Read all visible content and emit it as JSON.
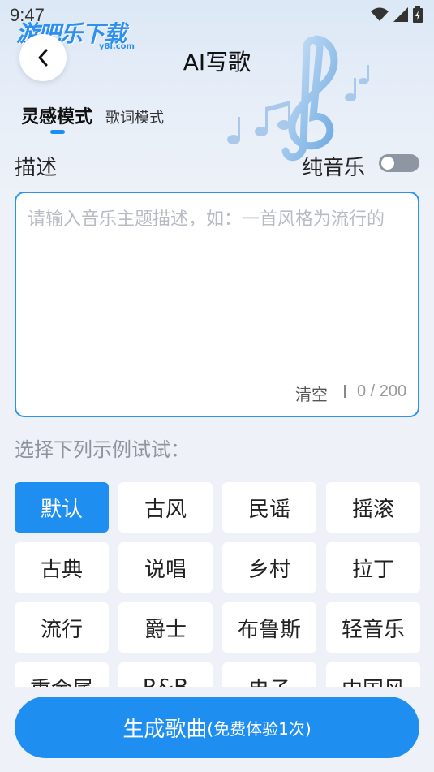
{
  "status": {
    "time": "9:47"
  },
  "watermark": {
    "name": "游吧乐下载",
    "domain": "y8l.com"
  },
  "header": {
    "title": "AI写歌",
    "back_icon": "chevron-left-icon"
  },
  "tabs": [
    {
      "label": "灵感模式",
      "active": true
    },
    {
      "label": "歌词模式",
      "active": false
    }
  ],
  "form": {
    "description_label": "描述",
    "pure_music_label": "纯音乐",
    "pure_music_on": false,
    "placeholder": "请输入音乐主题描述，如：一首风格为流行的",
    "clear_label": "清空",
    "char_count": "0 / 200"
  },
  "examples": {
    "label": "选择下列示例试试：",
    "styles": [
      "默认",
      "古风",
      "民谣",
      "摇滚",
      "古典",
      "说唱",
      "乡村",
      "拉丁",
      "流行",
      "爵士",
      "布鲁斯",
      "轻音乐",
      "重金属",
      "R&B",
      "电子",
      "中国风"
    ],
    "selected": "默认"
  },
  "action": {
    "generate_label": "生成歌曲",
    "generate_note": "(免费体验1次)"
  },
  "colors": {
    "accent": "#1f8ef1",
    "toggle_off": "#8e96a3"
  }
}
